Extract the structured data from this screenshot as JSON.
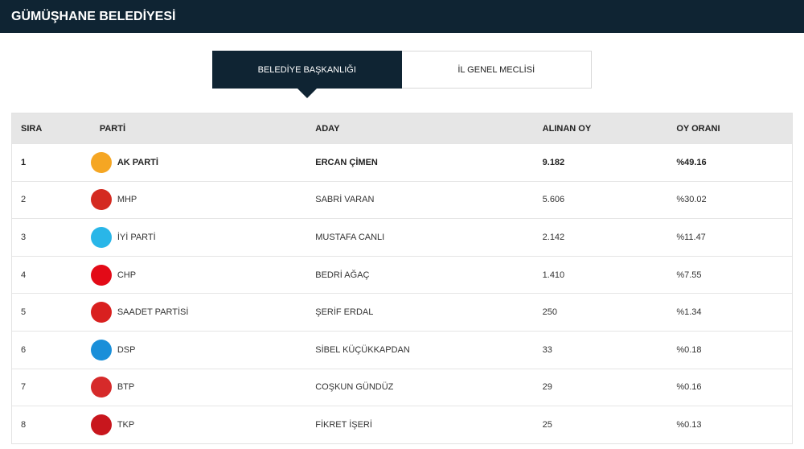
{
  "header": {
    "title": "GÜMÜŞHANE BELEDİYESİ"
  },
  "tabs": [
    {
      "label": "BELEDİYE BAŞKANLIĞI",
      "active": true
    },
    {
      "label": "İL GENEL MECLİSİ",
      "active": false
    }
  ],
  "table": {
    "columns": [
      "SIRA",
      "PARTİ",
      "ADAY",
      "ALINAN OY",
      "OY ORANI"
    ],
    "rows": [
      {
        "rank": "1",
        "party": "AK PARTİ",
        "candidate": "ERCAN ÇİMEN",
        "votes": "9.182",
        "share": "%49.16",
        "icon": "ak-parti-logo",
        "color": "#f5a623"
      },
      {
        "rank": "2",
        "party": "MHP",
        "candidate": "SABRİ VARAN",
        "votes": "5.606",
        "share": "%30.02",
        "icon": "mhp-logo",
        "color": "#d42a20"
      },
      {
        "rank": "3",
        "party": "İYİ PARTİ",
        "candidate": "MUSTAFA CANLI",
        "votes": "2.142",
        "share": "%11.47",
        "icon": "iyi-parti-logo",
        "color": "#29b6e8"
      },
      {
        "rank": "4",
        "party": "CHP",
        "candidate": "BEDRİ AĞAÇ",
        "votes": "1.410",
        "share": "%7.55",
        "icon": "chp-logo",
        "color": "#e30a17"
      },
      {
        "rank": "5",
        "party": "SAADET PARTİSİ",
        "candidate": "ŞERİF ERDAL",
        "votes": "250",
        "share": "%1.34",
        "icon": "saadet-logo",
        "color": "#d9201f"
      },
      {
        "rank": "6",
        "party": "DSP",
        "candidate": "SİBEL KÜÇÜKKAPDAN",
        "votes": "33",
        "share": "%0.18",
        "icon": "dsp-logo",
        "color": "#1a8fd9"
      },
      {
        "rank": "7",
        "party": "BTP",
        "candidate": "COŞKUN GÜNDÜZ",
        "votes": "29",
        "share": "%0.16",
        "icon": "btp-logo",
        "color": "#d62a2a"
      },
      {
        "rank": "8",
        "party": "TKP",
        "candidate": "FİKRET İŞERİ",
        "votes": "25",
        "share": "%0.13",
        "icon": "tkp-logo",
        "color": "#c8161d"
      }
    ]
  }
}
